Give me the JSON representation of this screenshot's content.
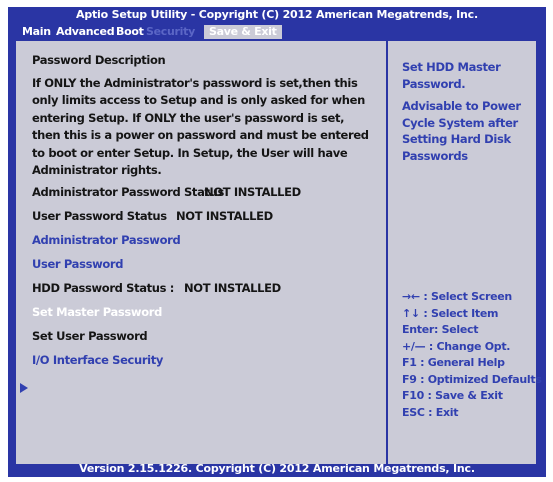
{
  "header": {
    "title": "Aptio Setup Utility - Copyright (C) 2012 American Megatrends, Inc."
  },
  "tabs": [
    {
      "label": "Main"
    },
    {
      "label": "Advanced"
    },
    {
      "label": "Boot"
    },
    {
      "label": "Security"
    },
    {
      "label": "Save & Exit"
    }
  ],
  "left": {
    "password_description_heading": "Password Description",
    "password_description_text": "If ONLY the Administrator's password is set,then this only limits access to Setup and is only asked for when entering Setup. If ONLY the user's password is set, then this is a power on password and must be entered to boot or enter Setup. In Setup, the User will have Administrator rights.",
    "admin_status_label": "Administrator Password Status",
    "admin_status_value": "NOT INSTALLED",
    "user_status_label": "User Password Status",
    "user_status_value": "NOT INSTALLED",
    "admin_password": "Administrator Password",
    "user_password": "User Password",
    "hdd_status_label": "HDD Password Status :",
    "hdd_status_value": "NOT INSTALLED",
    "set_master_password": "Set Master Password",
    "set_user_password": "Set User Password",
    "io_interface_security": "I/O Interface Security"
  },
  "right": {
    "help_title": "Set HDD Master Password.",
    "help_text": "Advisable to Power Cycle System after Setting Hard Disk Passwords",
    "keys": [
      "→←    : Select Screen",
      "↑↓  : Select Item",
      "Enter: Select",
      "+/— : Change Opt.",
      "F1  : General Help",
      "F9  : Optimized Defaults",
      "F10 : Save & Exit",
      "ESC : Exit"
    ]
  },
  "footer": {
    "version": "Version 2.15.1226. Copyright (C) 2012 American Megatrends, Inc."
  },
  "colors": {
    "background_blue": "#2a35a4",
    "panel_gray": "#cbcbd7",
    "option_blue": "#3140b0"
  }
}
